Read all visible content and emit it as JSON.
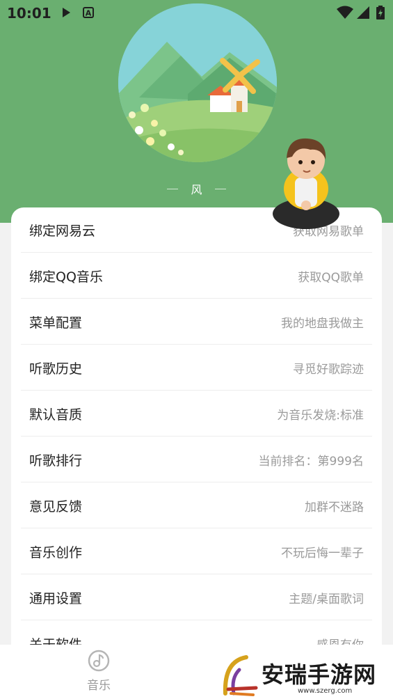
{
  "status_bar": {
    "time": "10:01",
    "icons": [
      "play-icon",
      "a-notification-icon",
      "wifi-icon",
      "signal-icon",
      "battery-charging-icon"
    ]
  },
  "profile": {
    "avatar": "windmill-landscape-avatar",
    "name": "风"
  },
  "menu": [
    {
      "title": "绑定网易云",
      "subtitle": "获取网易歌单"
    },
    {
      "title": "绑定QQ音乐",
      "subtitle": "获取QQ歌单"
    },
    {
      "title": "菜单配置",
      "subtitle": "我的地盘我做主"
    },
    {
      "title": "听歌历史",
      "subtitle": "寻觅好歌踪迹"
    },
    {
      "title": "默认音质",
      "subtitle": "为音乐发烧:标准"
    },
    {
      "title": "听歌排行",
      "subtitle": "当前排名：第999名"
    },
    {
      "title": "意见反馈",
      "subtitle": "加群不迷路"
    },
    {
      "title": "音乐创作",
      "subtitle": "不玩后悔一辈子"
    },
    {
      "title": "通用设置",
      "subtitle": "主题/桌面歌词"
    },
    {
      "title": "关于软件",
      "subtitle": "感恩有你"
    }
  ],
  "bottom_nav": {
    "music_label": "音乐",
    "music_icon": "music-note-icon"
  },
  "watermark": {
    "text": "安瑞手游网",
    "url": "www.szerg.com"
  },
  "colors": {
    "header_green": "#6aaf70",
    "text_primary": "#222222",
    "text_secondary": "#9a9a9a"
  }
}
